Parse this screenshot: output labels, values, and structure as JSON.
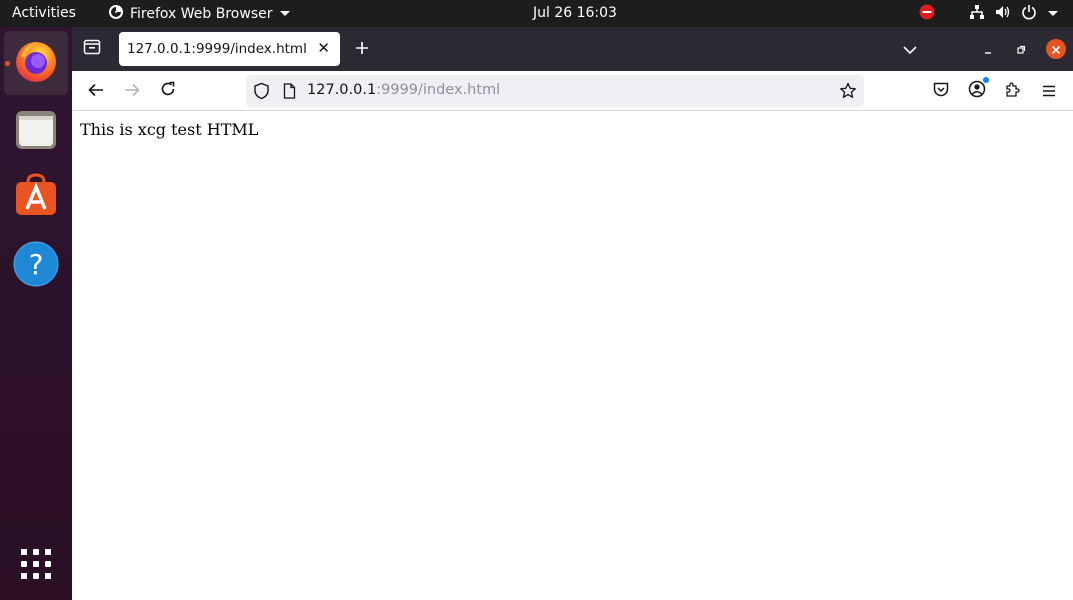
{
  "topbar": {
    "activities": "Activities",
    "app_name": "Firefox Web Browser",
    "datetime": "Jul 26  16:03"
  },
  "dock": {
    "apps": [
      "firefox",
      "files",
      "app-center",
      "help"
    ]
  },
  "browser": {
    "tab": {
      "title": "127.0.0.1:9999/index.html"
    },
    "url": {
      "host": "127.0.0.1",
      "path": ":9999/index.html"
    }
  },
  "page": {
    "content_text": "This is xcg test HTML"
  },
  "colors": {
    "accent": "#e95420",
    "topbar_bg": "#1d1d1d",
    "tabstrip_bg": "#2b2a33",
    "close_button": "#e95420"
  }
}
